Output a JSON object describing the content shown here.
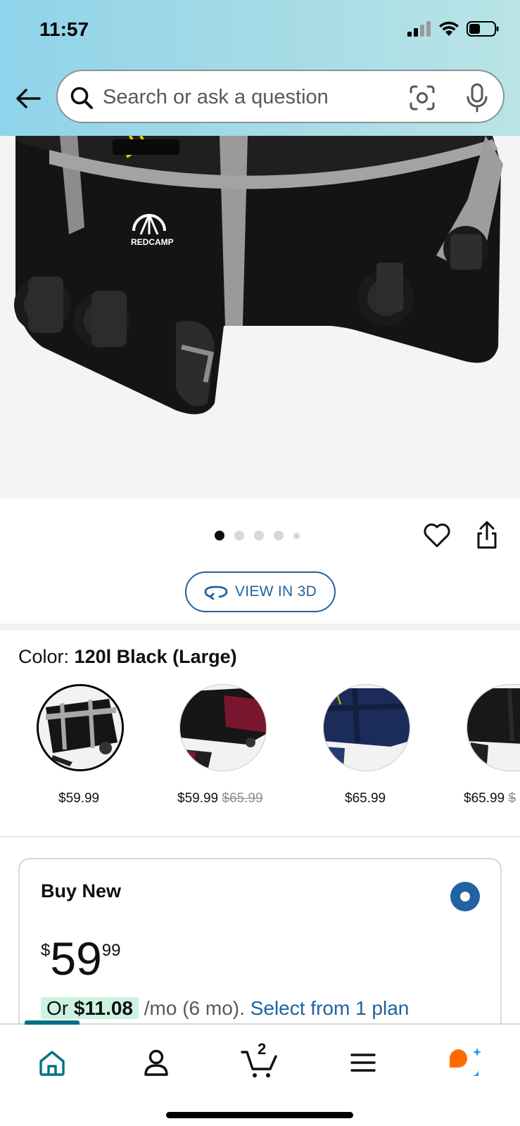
{
  "status_bar": {
    "time": "11:57"
  },
  "search": {
    "placeholder": "Search or ask a question"
  },
  "product_image": {
    "brand_mark": "REDCAMP"
  },
  "carousel": {
    "total": 5,
    "active": 1
  },
  "view_3d": {
    "label": "VIEW IN 3D"
  },
  "color": {
    "label": "Color:",
    "value": "120l Black (Large)"
  },
  "swatches": [
    {
      "price": "$59.99",
      "list_price": "",
      "color": "black-gray"
    },
    {
      "price": "$59.99",
      "list_price": "$65.99",
      "color": "black-red"
    },
    {
      "price": "$65.99",
      "list_price": "",
      "color": "navy"
    },
    {
      "price": "$65.99",
      "list_price": "$",
      "color": "black"
    }
  ],
  "buy_box": {
    "title": "Buy New",
    "price_currency": "$",
    "price_whole": "59",
    "price_fraction": "99",
    "installment_prefix": "Or",
    "installment_amount": "$11.08",
    "installment_term": "/mo (6 mo).",
    "installment_link": "Select from 1 plan"
  },
  "bottom_nav": {
    "items": [
      "home-icon",
      "account-icon",
      "cart-icon",
      "menu-icon",
      "rufus-icon"
    ],
    "cart_count": "2",
    "active": "home"
  },
  "colors": {
    "link": "#2162a1",
    "accent_teal": "#007185",
    "highlight": "#cdf2e0",
    "rufus_orange": "#ff6a00",
    "rufus_blue": "#1a98ff"
  }
}
